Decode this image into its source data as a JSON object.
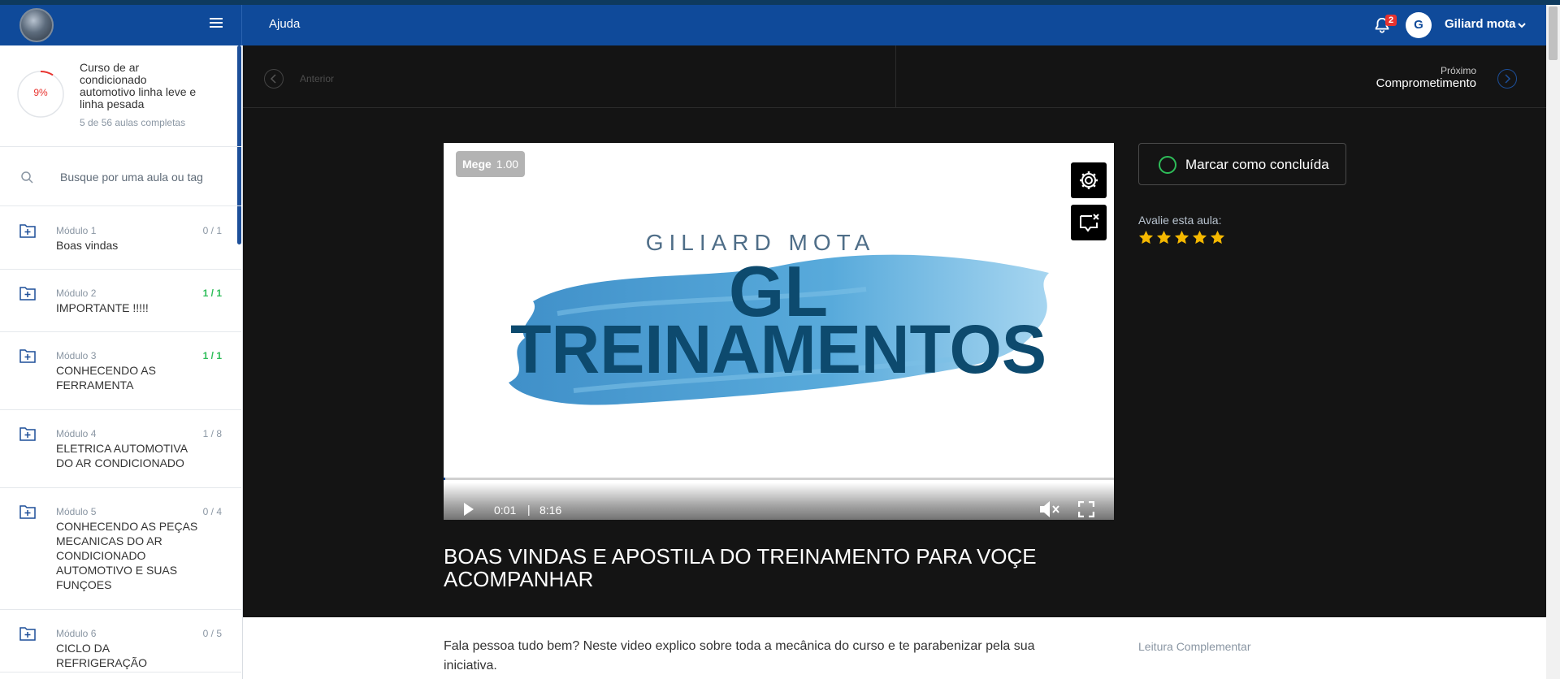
{
  "header": {
    "help_label": "Ajuda",
    "notifications_count": "2",
    "avatar_initials": "G",
    "username": "Giliard mota"
  },
  "sidebar": {
    "progress_percent_label": "9%",
    "progress_fraction": 0.09,
    "course_title": "Curso de ar condicionado automotivo linha leve e linha pesada",
    "lessons_completed": "5 de 56 aulas completas",
    "search_placeholder": "Busque por uma aula ou tag",
    "modules": [
      {
        "number": "Módulo 1",
        "name": "Boas vindas",
        "count": "0 / 1",
        "complete": false
      },
      {
        "number": "Módulo 2",
        "name": "IMPORTANTE !!!!!",
        "count": "1 / 1",
        "complete": true
      },
      {
        "number": "Módulo 3",
        "name": "CONHECENDO AS FERRAMENTA",
        "count": "1 / 1",
        "complete": true
      },
      {
        "number": "Módulo 4",
        "name": "ELETRICA AUTOMOTIVA DO AR CONDICIONADO",
        "count": "1 / 8",
        "complete": false
      },
      {
        "number": "Módulo 5",
        "name": "CONHECENDO AS PEÇAS MECANICAS DO AR CONDICIONADO AUTOMOTIVO E SUAS FUNÇOES",
        "count": "0 / 4",
        "complete": false
      },
      {
        "number": "Módulo 6",
        "name": "CICLO DA REFRIGERAÇÃO",
        "count": "0 / 5",
        "complete": false
      }
    ]
  },
  "lesson_nav": {
    "prev_label": "Anterior",
    "next_small": "Próximo",
    "next_title": "Comprometimento"
  },
  "video": {
    "speed_label": "Mege",
    "speed_value": "1.00",
    "brand_top": "GILIARD MOTA",
    "brand_line1": "GL",
    "brand_line2": "TREINAMENTOS",
    "current_time": "0:01",
    "duration": "8:16",
    "played_fraction": 0.002
  },
  "lesson": {
    "title": "BOAS VINDAS E APOSTILA DO TREINAMENTO PARA VOÇE ACOMPANHAR",
    "description": "Fala pessoa tudo bem? Neste video explico sobre toda a mecânica do curso e te parabenizar pela sua iniciativa.",
    "reading_label": "Leitura Complementar"
  },
  "actions": {
    "complete_label": "Marcar como concluída",
    "rate_label": "Avalie esta aula:",
    "rating": 5
  },
  "colors": {
    "brand_blue": "#0f4a9a",
    "success_green": "#2ebd59",
    "alert_red": "#e8332f",
    "star_yellow": "#f5b800"
  }
}
